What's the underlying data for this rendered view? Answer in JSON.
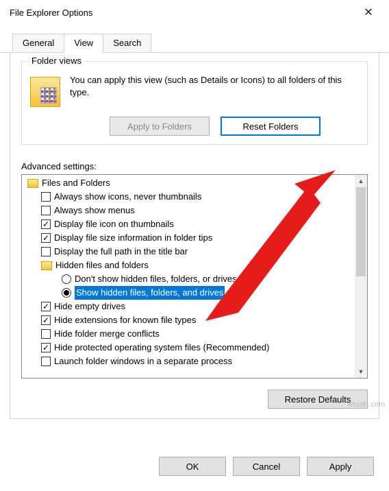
{
  "window": {
    "title": "File Explorer Options",
    "close_glyph": "✕"
  },
  "tabs": [
    {
      "label": "General"
    },
    {
      "label": "View"
    },
    {
      "label": "Search"
    }
  ],
  "folder_views": {
    "legend": "Folder views",
    "text": "You can apply this view (such as Details or Icons) to all folders of this type.",
    "apply_btn": "Apply to Folders",
    "reset_btn": "Reset Folders"
  },
  "advanced": {
    "label": "Advanced settings:",
    "items": [
      {
        "type": "folder",
        "level": 0,
        "text": "Files and Folders"
      },
      {
        "type": "check",
        "checked": false,
        "level": 1,
        "text": "Always show icons, never thumbnails"
      },
      {
        "type": "check",
        "checked": false,
        "level": 1,
        "text": "Always show menus"
      },
      {
        "type": "check",
        "checked": true,
        "level": 1,
        "text": "Display file icon on thumbnails"
      },
      {
        "type": "check",
        "checked": true,
        "level": 1,
        "text": "Display file size information in folder tips"
      },
      {
        "type": "check",
        "checked": false,
        "level": 1,
        "text": "Display the full path in the title bar"
      },
      {
        "type": "folder",
        "level": 1,
        "text": "Hidden files and folders"
      },
      {
        "type": "radio",
        "selected": false,
        "level": 2,
        "text": "Don't show hidden files, folders, or drives"
      },
      {
        "type": "radio",
        "selected": true,
        "highlight": true,
        "level": 2,
        "text": "Show hidden files, folders, and drives"
      },
      {
        "type": "check",
        "checked": true,
        "level": 1,
        "text": "Hide empty drives"
      },
      {
        "type": "check",
        "checked": true,
        "level": 1,
        "text": "Hide extensions for known file types"
      },
      {
        "type": "check",
        "checked": false,
        "level": 1,
        "text": "Hide folder merge conflicts"
      },
      {
        "type": "check",
        "checked": true,
        "level": 1,
        "text": "Hide protected operating system files (Recommended)"
      },
      {
        "type": "check",
        "checked": false,
        "level": 1,
        "text": "Launch folder windows in a separate process"
      }
    ],
    "restore_btn": "Restore Defaults"
  },
  "dialog_buttons": {
    "ok": "OK",
    "cancel": "Cancel",
    "apply": "Apply"
  },
  "watermark": "wsxdn.com"
}
